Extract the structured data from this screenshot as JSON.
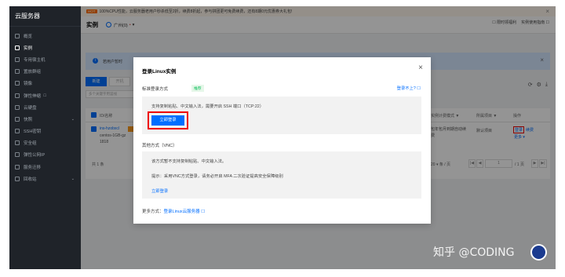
{
  "sidebar": {
    "title": "云服务器",
    "items": [
      {
        "label": "概览",
        "icon": "grid-icon"
      },
      {
        "label": "实例",
        "icon": "cloud-icon",
        "active": true
      },
      {
        "label": "专用宿主机",
        "icon": "host-icon"
      },
      {
        "label": "置放群组",
        "icon": "group-icon"
      },
      {
        "label": "镜像",
        "icon": "image-icon"
      },
      {
        "label": "弹性伸缩",
        "icon": "scale-icon",
        "ext": "☐"
      },
      {
        "label": "云硬盘",
        "icon": "disk-icon"
      },
      {
        "label": "快照",
        "icon": "snapshot-icon",
        "arrow": "⌄"
      },
      {
        "label": "SSH密钥",
        "icon": "key-icon"
      },
      {
        "label": "安全组",
        "icon": "shield-icon"
      },
      {
        "label": "弹性公网IP",
        "icon": "ip-icon"
      },
      {
        "label": "服务迁移",
        "icon": "migrate-icon"
      },
      {
        "label": "回收站",
        "icon": "trash-icon",
        "arrow": "⌄"
      }
    ]
  },
  "notice": {
    "hot": "HOT",
    "text": "100%CPU性能，云服务器老用户秒杀低至2折，续费8折起，参与拼团更可免费续费，还有8期0元优惠券大礼包!",
    "close": "×"
  },
  "topbar": {
    "title": "实例",
    "region": "广州(0)",
    "region_caret": "▾",
    "right_links": [
      "☐ 限时领福利",
      "实例使用指南 ☐"
    ]
  },
  "info_banner": {
    "text": "若用户暂时",
    "close": "×"
  },
  "toolbar": {
    "new": "新建",
    "open": "开机",
    "search_placeholder": "多个关键字用竖线",
    "tools": [
      "⟳",
      "⚙",
      "⤓"
    ]
  },
  "table": {
    "headers": {
      "id": "ID/名称",
      "billing": "实例计费模式 ▼",
      "project": "所属项目 ▼",
      "ops": "操作"
    },
    "row": {
      "name": "ins-hzobxcl",
      "image": "centos-1GB-gz",
      "size": "1818",
      "billing": "包年包月到期自动续费",
      "project": "默认项目",
      "login": "登录",
      "renew": "续费",
      "more": "更多 ▾"
    },
    "pager": {
      "total": "共 1 条",
      "per_page": "20 ▾ 条 / 页",
      "first": "|◀",
      "prev": "◀",
      "page": "1",
      "page_of": "/ 1 页",
      "next": "▶",
      "last": "▶|"
    }
  },
  "dialog": {
    "title": "登录Linux实例",
    "close": "×",
    "standard_label": "标准登录方式",
    "recommend": "推荐",
    "login_fail": "登录不上? ☐",
    "standard_desc": "支持复制粘贴、中文输入法，需要开启 SSH 端口（TCP:22）",
    "login_button": "立即登录",
    "other_label": "其他方式（VNC）",
    "vnc_desc": "该方式暂不支持复制粘贴、中文输入法。",
    "vnc_hint": "提示：采用VNC方式登录，请务必开启 MFA 二次验证提高安全保障级别",
    "vnc_login": "立即登录",
    "more_ways_prefix": "更多方式：",
    "more_ways_link": "登录Linux云服务器 ☐"
  },
  "watermark": "知乎 @CODING"
}
